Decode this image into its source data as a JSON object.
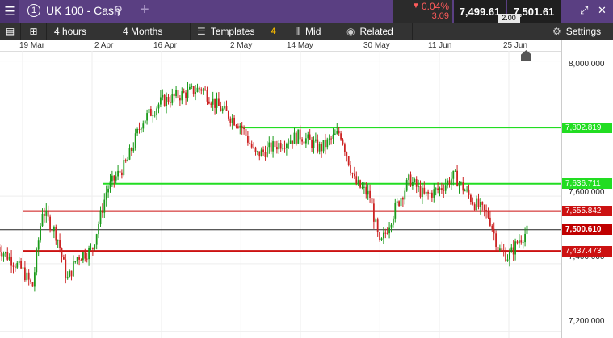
{
  "header": {
    "menu_icon": "hamburger-icon",
    "instrument_number": "1",
    "instrument_title": "UK 100 - Cash",
    "search_icon": "search-icon",
    "add_icon": "plus-icon",
    "change_pct": "0.04%",
    "change_abs": "3.09",
    "sell_price": "7,499.61",
    "buy_price": "7,501.61",
    "spread": "2.00"
  },
  "toolbar": {
    "interval": "4 hours",
    "range": "4 Months",
    "templates_label": "Templates",
    "templates_count": "4",
    "price_type": "Mid",
    "related_label": "Related",
    "settings_label": "Settings"
  },
  "colors": {
    "support_green": "#22dd22",
    "resistance_red": "#cc1111",
    "candle_up": "#1a9a1a",
    "candle_down": "#cc2222",
    "current_price_bg": "#c00000",
    "green_label_bg": "#22dd22"
  },
  "chart_data": {
    "type": "candlestick",
    "x_ticks": [
      "19 Mar",
      "2 Apr",
      "16 Apr",
      "2 May",
      "14 May",
      "30 May",
      "11 Jun",
      "25 Jun"
    ],
    "y_ticks": [
      "8,000.000",
      "7,600.000",
      "7,400.000",
      "7,200.000"
    ],
    "ylim": [
      7180,
      8030
    ],
    "current_price": "7,500.610",
    "levels": [
      {
        "label": "7,802.819",
        "value": 7802.819,
        "kind": "green",
        "start_date": "2 May"
      },
      {
        "label": "7,636.711",
        "value": 7636.711,
        "kind": "green",
        "start_date": "2 Apr"
      },
      {
        "label": "7,555.842",
        "value": 7555.842,
        "kind": "red",
        "start_date": "19 Mar"
      },
      {
        "label": "7,437.473",
        "value": 7437.473,
        "kind": "red",
        "start_date": "19 Mar"
      }
    ],
    "price_path": [
      [
        "14 Mar",
        7450
      ],
      [
        "19 Mar",
        7380
      ],
      [
        "21 Mar",
        7330
      ],
      [
        "23 Mar",
        7560
      ],
      [
        "26 Mar",
        7480
      ],
      [
        "28 Mar",
        7350
      ],
      [
        "30 Mar",
        7420
      ],
      [
        "2 Apr",
        7440
      ],
      [
        "5 Apr",
        7620
      ],
      [
        "9 Apr",
        7700
      ],
      [
        "12 Apr",
        7820
      ],
      [
        "16 Apr",
        7880
      ],
      [
        "20 Apr",
        7900
      ],
      [
        "24 Apr",
        7920
      ],
      [
        "27 Apr",
        7870
      ],
      [
        "2 May",
        7810
      ],
      [
        "5 May",
        7720
      ],
      [
        "9 May",
        7750
      ],
      [
        "14 May",
        7780
      ],
      [
        "18 May",
        7740
      ],
      [
        "22 May",
        7790
      ],
      [
        "25 May",
        7640
      ],
      [
        "28 May",
        7600
      ],
      [
        "30 May",
        7450
      ],
      [
        "2 Jun",
        7560
      ],
      [
        "5 Jun",
        7650
      ],
      [
        "8 Jun",
        7600
      ],
      [
        "11 Jun",
        7620
      ],
      [
        "14 Jun",
        7660
      ],
      [
        "18 Jun",
        7580
      ],
      [
        "21 Jun",
        7540
      ],
      [
        "23 Jun",
        7440
      ],
      [
        "25 Jun",
        7420
      ],
      [
        "27 Jun",
        7470
      ],
      [
        "29 Jun",
        7500
      ]
    ]
  }
}
